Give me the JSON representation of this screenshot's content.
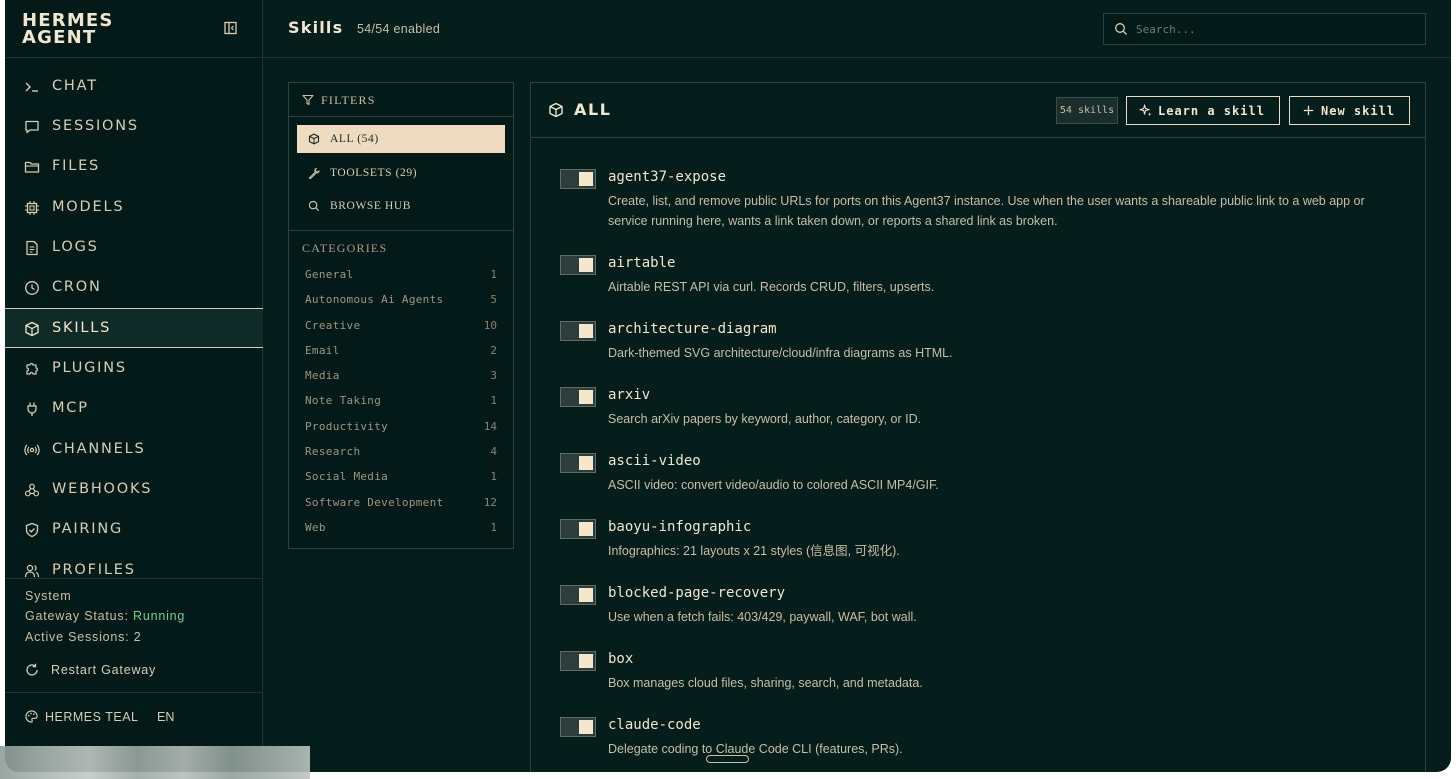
{
  "brand": {
    "title": "HERMES AGENT"
  },
  "nav": [
    {
      "id": "chat",
      "label": "CHAT",
      "icon": "terminal-icon"
    },
    {
      "id": "sessions",
      "label": "SESSIONS",
      "icon": "message-square-icon"
    },
    {
      "id": "files",
      "label": "FILES",
      "icon": "folder-icon"
    },
    {
      "id": "models",
      "label": "MODELS",
      "icon": "cpu-icon"
    },
    {
      "id": "logs",
      "label": "LOGS",
      "icon": "file-text-icon"
    },
    {
      "id": "cron",
      "label": "CRON",
      "icon": "clock-icon"
    },
    {
      "id": "skills",
      "label": "SKILLS",
      "icon": "package-icon",
      "active": true
    },
    {
      "id": "plugins",
      "label": "PLUGINS",
      "icon": "puzzle-icon"
    },
    {
      "id": "mcp",
      "label": "MCP",
      "icon": "plug-icon"
    },
    {
      "id": "channels",
      "label": "CHANNELS",
      "icon": "radio-icon"
    },
    {
      "id": "webhooks",
      "label": "WEBHOOKS",
      "icon": "webhook-icon"
    },
    {
      "id": "pairing",
      "label": "PAIRING",
      "icon": "shield-check-icon"
    },
    {
      "id": "profiles",
      "label": "PROFILES",
      "icon": "users-icon"
    }
  ],
  "system": {
    "heading": "System",
    "gateway_label": "Gateway Status:",
    "gateway_status": "Running",
    "sessions_label": "Active Sessions:",
    "sessions_count": "2",
    "restart_label": "Restart Gateway"
  },
  "footer": {
    "theme_label": "HERMES TEAL",
    "lang_label": "EN"
  },
  "header": {
    "title": "Skills",
    "enabled_count": "54/54 enabled",
    "search_placeholder": "Search..."
  },
  "filters": {
    "heading": "FILTERS",
    "options": [
      {
        "label": "ALL (54)",
        "icon": "package-icon",
        "active": true
      },
      {
        "label": "TOOLSETS (29)",
        "icon": "wrench-icon"
      },
      {
        "label": "BROWSE HUB",
        "icon": "search-icon"
      }
    ],
    "categories_heading": "CATEGORIES",
    "categories": [
      {
        "name": "General",
        "count": "1"
      },
      {
        "name": "Autonomous Ai Agents",
        "count": "5"
      },
      {
        "name": "Creative",
        "count": "10"
      },
      {
        "name": "Email",
        "count": "2"
      },
      {
        "name": "Media",
        "count": "3"
      },
      {
        "name": "Note Taking",
        "count": "1"
      },
      {
        "name": "Productivity",
        "count": "14"
      },
      {
        "name": "Research",
        "count": "4"
      },
      {
        "name": "Social Media",
        "count": "1"
      },
      {
        "name": "Software Development",
        "count": "12"
      },
      {
        "name": "Web",
        "count": "1"
      }
    ]
  },
  "skills_panel": {
    "title": "ALL",
    "badge": "54 skills",
    "learn_label": "Learn a skill",
    "new_label": "New skill",
    "items": [
      {
        "name": "agent37-expose",
        "enabled": true,
        "description": "Create, list, and remove public URLs for ports on this Agent37 instance. Use when the user wants a shareable public link to a web app or service running here, wants a link taken down, or reports a shared link as broken."
      },
      {
        "name": "airtable",
        "enabled": true,
        "description": "Airtable REST API via curl. Records CRUD, filters, upserts."
      },
      {
        "name": "architecture-diagram",
        "enabled": true,
        "description": "Dark-themed SVG architecture/cloud/infra diagrams as HTML."
      },
      {
        "name": "arxiv",
        "enabled": true,
        "description": "Search arXiv papers by keyword, author, category, or ID."
      },
      {
        "name": "ascii-video",
        "enabled": true,
        "description": "ASCII video: convert video/audio to colored ASCII MP4/GIF."
      },
      {
        "name": "baoyu-infographic",
        "enabled": true,
        "description": "Infographics: 21 layouts x 21 styles (信息图, 可视化)."
      },
      {
        "name": "blocked-page-recovery",
        "enabled": true,
        "description": "Use when a fetch fails: 403/429, paywall, WAF, bot wall."
      },
      {
        "name": "box",
        "enabled": true,
        "description": "Box manages cloud files, sharing, search, and metadata."
      },
      {
        "name": "claude-code",
        "enabled": true,
        "description": "Delegate coding to Claude Code CLI (features, PRs)."
      }
    ]
  },
  "colors": {
    "background": "#051d1b",
    "sidebar": "#041a18",
    "accent_cream": "#eddcc0",
    "text": "#e8dcc4",
    "status_running": "#6fcf8e"
  }
}
